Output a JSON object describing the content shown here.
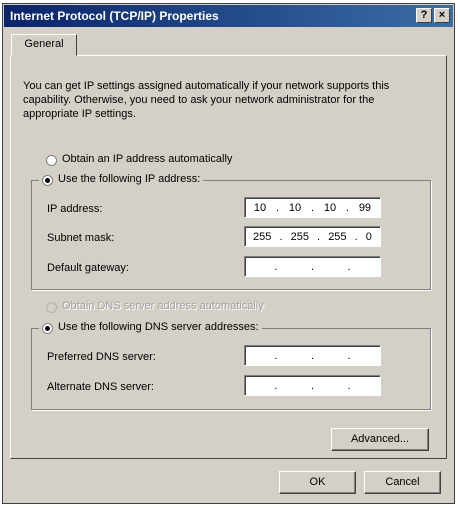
{
  "window": {
    "title": "Internet Protocol (TCP/IP) Properties"
  },
  "titlebar": {
    "help_glyph": "?",
    "close_glyph": "×"
  },
  "tabs": [
    {
      "label": "General"
    }
  ],
  "intro": "You can get IP settings assigned automatically if your network supports this capability. Otherwise, you need to ask your network administrator for the appropriate IP settings.",
  "ip_mode": {
    "auto_label": "Obtain an IP address automatically",
    "manual_label": "Use the following IP address:",
    "selected": "manual"
  },
  "ip_fields": [
    {
      "label": "IP address:",
      "octets": [
        "10",
        "10",
        "10",
        "99"
      ]
    },
    {
      "label": "Subnet mask:",
      "octets": [
        "255",
        "255",
        "255",
        "0"
      ]
    },
    {
      "label": "Default gateway:",
      "octets": [
        "",
        "",
        "",
        ""
      ]
    }
  ],
  "dns_mode": {
    "auto_label": "Obtain DNS server address automatically",
    "manual_label": "Use the following DNS server addresses:",
    "selected": "manual",
    "auto_disabled": true
  },
  "dns_fields": [
    {
      "label": "Preferred DNS server:",
      "octets": [
        "",
        "",
        "",
        ""
      ]
    },
    {
      "label": "Alternate DNS server:",
      "octets": [
        "",
        "",
        "",
        ""
      ]
    }
  ],
  "buttons": {
    "advanced": "Advanced...",
    "ok": "OK",
    "cancel": "Cancel"
  }
}
